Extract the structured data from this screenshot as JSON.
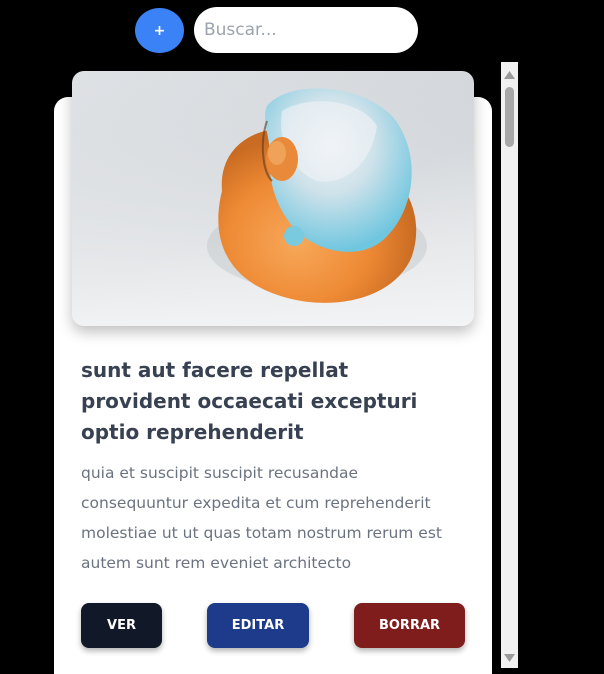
{
  "toolbar": {
    "add_label": "+",
    "search_placeholder": "Buscar..."
  },
  "card": {
    "image_alt": "orange and blue abstract shape",
    "title": "sunt aut facere repellat provident occaecati excepturi optio reprehenderit",
    "description": "quia et suscipit suscipit recusandae consequuntur expedita et cum reprehenderit molestiae ut ut quas totam nostrum rerum est autem sunt rem eveniet architecto",
    "buttons": {
      "view": "VER",
      "edit": "EDITAR",
      "delete": "BORRAR"
    }
  },
  "colors": {
    "background": "#000000",
    "add_button": "#3b82f6",
    "view_button": "#111827",
    "edit_button": "#1e3a8a",
    "delete_button": "#7f1d1d"
  }
}
